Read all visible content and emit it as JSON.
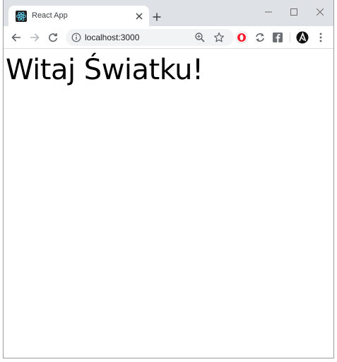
{
  "tab": {
    "title": "React App",
    "favicon": "react-logo-icon",
    "favicon_color": "#61dafb"
  },
  "window_controls": [
    "minimize-icon",
    "maximize-icon",
    "close-icon"
  ],
  "toolbar": {
    "url": "localhost:3000",
    "icons": [
      "back-icon",
      "forward-icon",
      "reload-icon",
      "info-icon",
      "zoom-icon",
      "star-icon",
      "opera-icon",
      "sync-icon",
      "facebook-icon",
      "profile-icon",
      "menu-icon"
    ]
  },
  "colors": {
    "tabstrip": "#dee1e6",
    "omnibox": "#f1f3f4",
    "opera_red": "#ff1b2d"
  },
  "page": {
    "heading": "Witaj Światku!"
  }
}
